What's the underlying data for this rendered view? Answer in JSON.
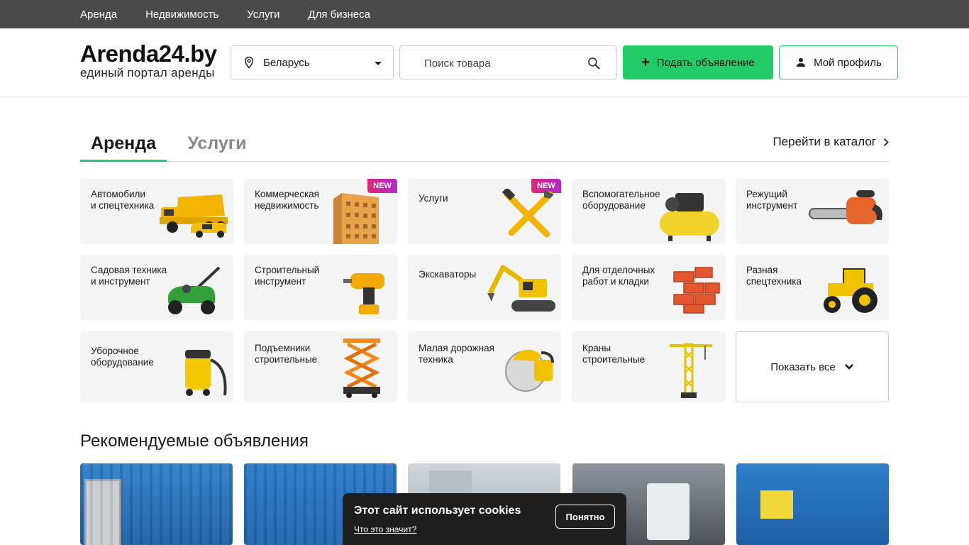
{
  "topnav": [
    "Аренда",
    "Недвижимость",
    "Услуги",
    "Для бизнеса"
  ],
  "logo": {
    "name": "Arenda24.by",
    "tagline": "единый портал аренды"
  },
  "region": {
    "value": "Беларусь"
  },
  "search": {
    "placeholder": "Поиск товара"
  },
  "buttons": {
    "post": "Подать объявление",
    "profile": "Мой профиль"
  },
  "tabs": {
    "active": "Аренда",
    "inactive": "Услуги",
    "catalog_link": "Перейти в каталог"
  },
  "categories": [
    {
      "label": "Автомобили\nи спецтехника",
      "icon": "dump-truck-icon",
      "badge": ""
    },
    {
      "label": "Коммерческая\nнедвижимость",
      "icon": "building-icon",
      "badge": "NEW"
    },
    {
      "label": "Услуги",
      "icon": "hammer-wrench-icon",
      "badge": "NEW"
    },
    {
      "label": "Вспомогательное\nоборудование",
      "icon": "compressor-icon",
      "badge": ""
    },
    {
      "label": "Режущий\nинструмент",
      "icon": "chainsaw-icon",
      "badge": ""
    },
    {
      "label": "Садовая техника\nи инструмент",
      "icon": "lawnmower-icon",
      "badge": ""
    },
    {
      "label": "Строительный\nинструмент",
      "icon": "drill-icon",
      "badge": ""
    },
    {
      "label": "Экскаваторы",
      "icon": "excavator-icon",
      "badge": ""
    },
    {
      "label": "Для отделочных\nработ и кладки",
      "icon": "bricks-icon",
      "badge": ""
    },
    {
      "label": "Разная\nспецтехника",
      "icon": "tractor-icon",
      "badge": ""
    },
    {
      "label": "Уборочное\nоборудование",
      "icon": "vacuum-icon",
      "badge": ""
    },
    {
      "label": "Подъемники\nстроительные",
      "icon": "scissor-lift-icon",
      "badge": ""
    },
    {
      "label": "Малая дорожная\nтехника",
      "icon": "cutter-icon",
      "badge": ""
    },
    {
      "label": "Краны\nстроительные",
      "icon": "crane-icon",
      "badge": ""
    }
  ],
  "show_all": "Показать все",
  "recommended": {
    "title": "Рекомендуемые объявления"
  },
  "cookie": {
    "title": "Этот сайт использует cookies",
    "link": "Что это значит?",
    "button": "Понятно"
  },
  "colors": {
    "accent": "#23cc68",
    "topbar": "#4a4a4a",
    "card_bg": "#f4f4f4",
    "badge": "#e0287d"
  }
}
